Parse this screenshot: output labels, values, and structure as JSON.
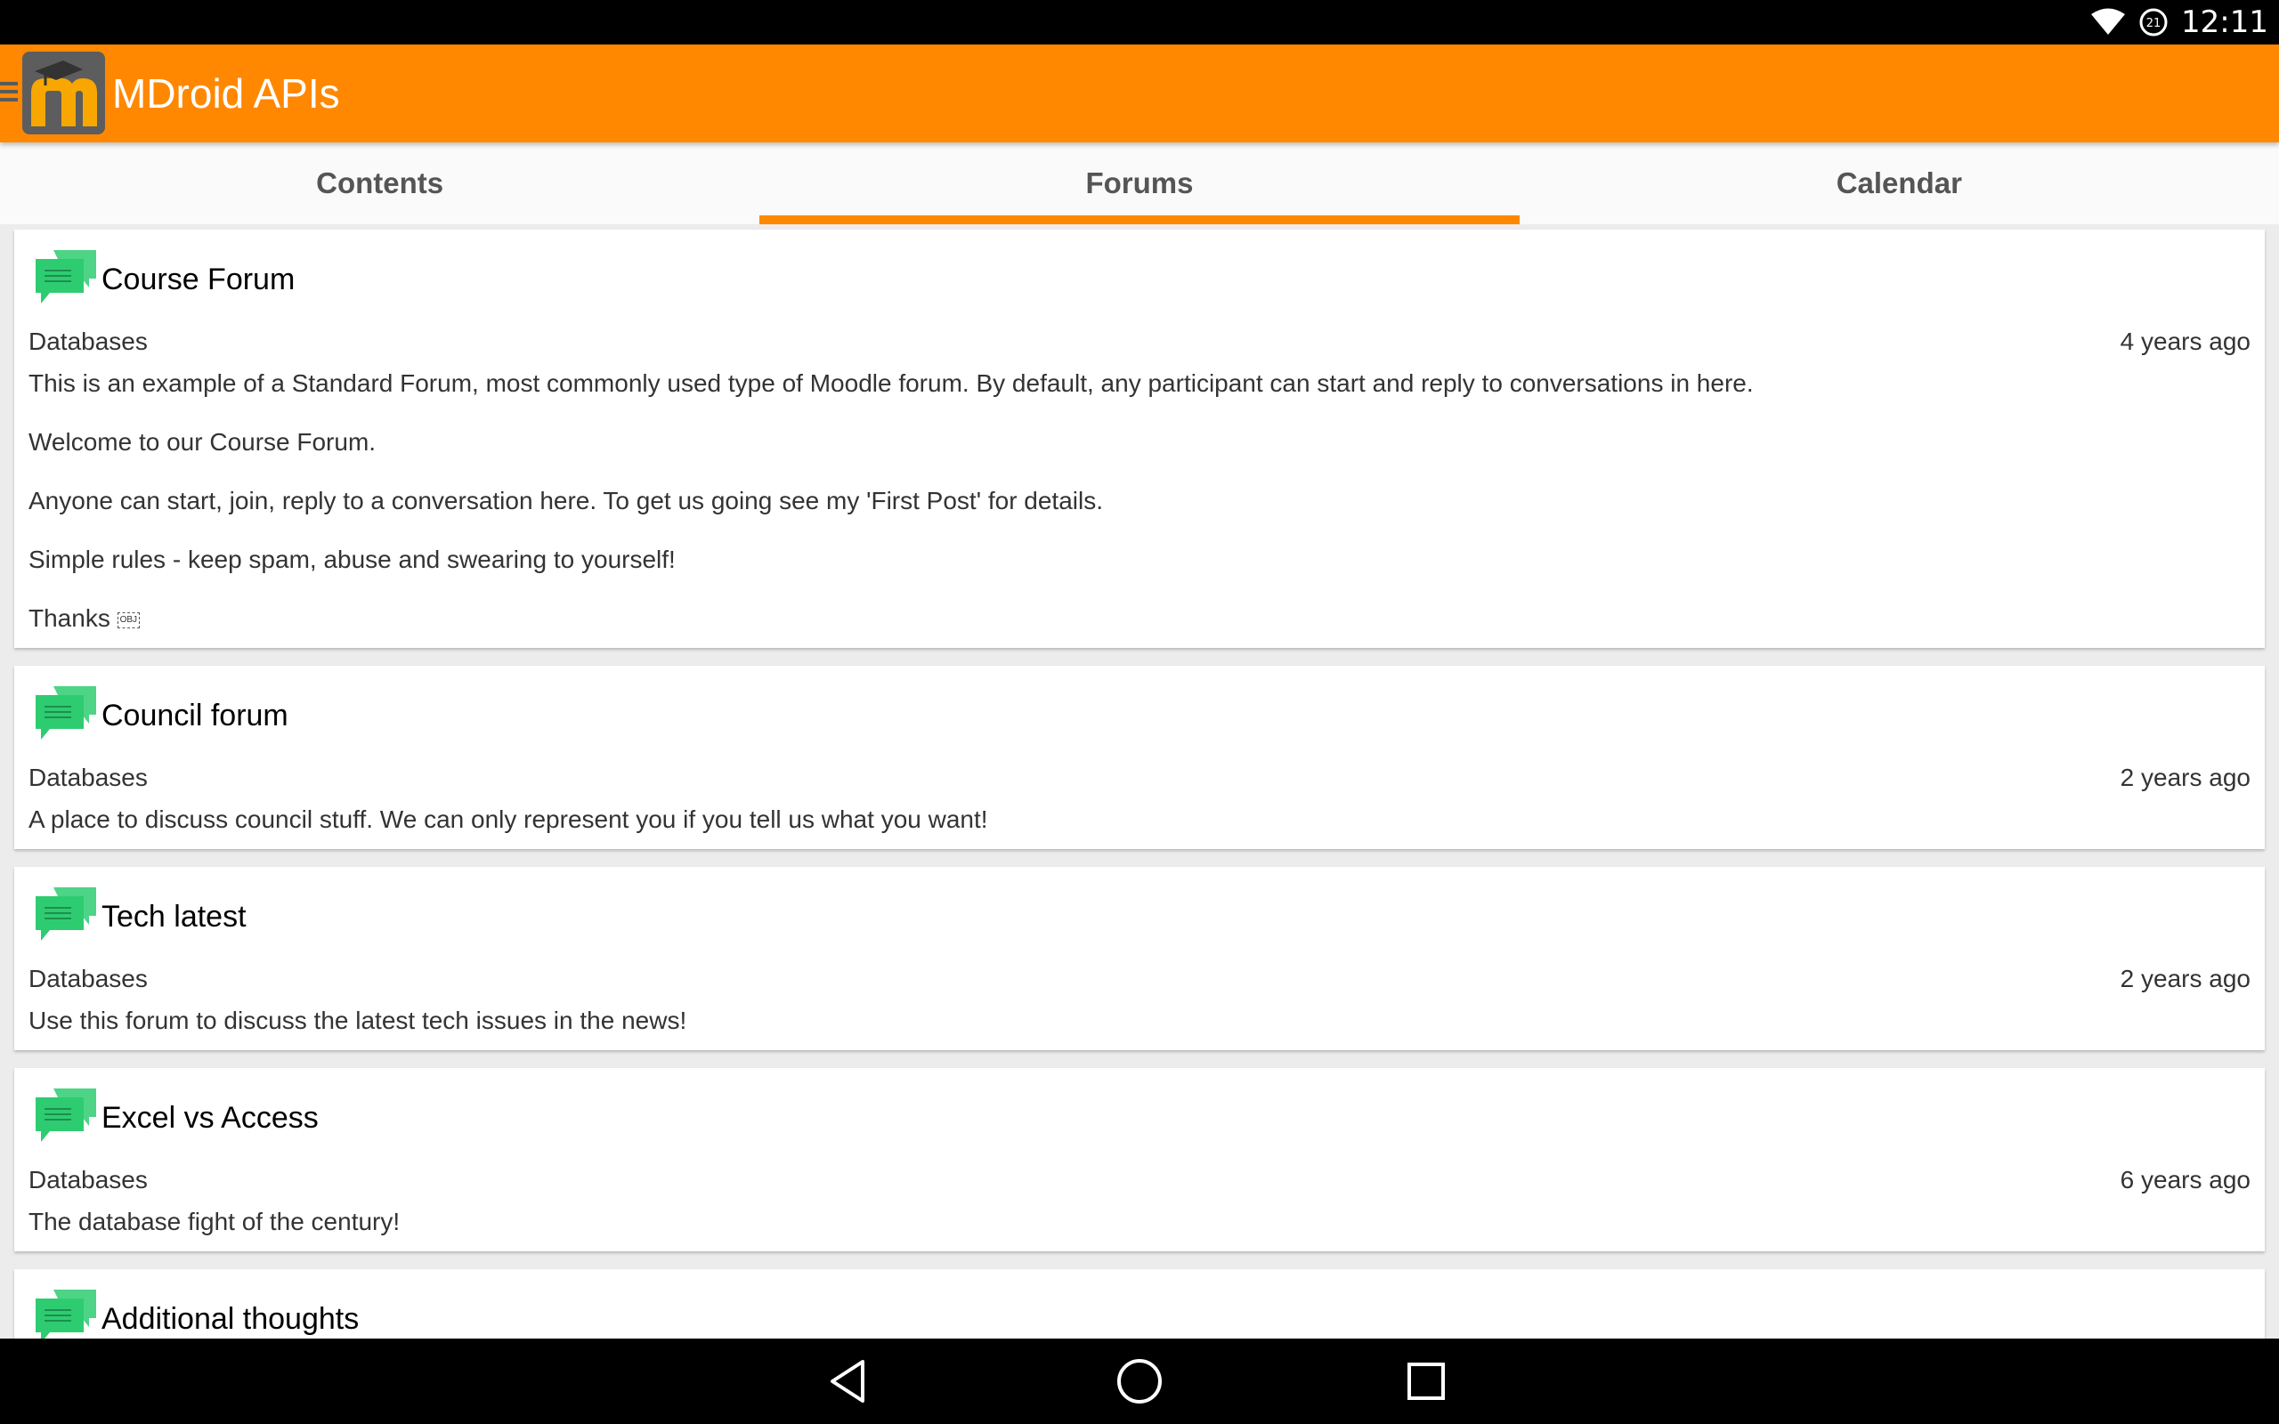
{
  "status_bar": {
    "time": "12:11",
    "battery_level": "21"
  },
  "app_bar": {
    "title": "MDroid APIs"
  },
  "tabs": [
    {
      "label": "Contents",
      "active": false
    },
    {
      "label": "Forums",
      "active": true
    },
    {
      "label": "Calendar",
      "active": false
    }
  ],
  "forums": [
    {
      "title": "Course Forum",
      "category": "Databases",
      "time": "4 years ago",
      "paragraphs": [
        "This is an example of a Standard Forum, most commonly used type of Moodle forum. By default, any participant can start and reply to conversations in here.",
        "Welcome to our Course Forum.",
        "Anyone can start, join, reply to a conversation here. To get us going see my 'First Post' for details.",
        "Simple rules - keep spam, abuse and swearing to yourself!",
        "Thanks"
      ],
      "obj_marker": "OBJ"
    },
    {
      "title": "Council forum",
      "category": "Databases",
      "time": "2 years ago",
      "paragraphs": [
        "A place to discuss council stuff. We can only represent you if you tell us what you want!"
      ]
    },
    {
      "title": "Tech latest",
      "category": "Databases",
      "time": "2 years ago",
      "paragraphs": [
        "Use this forum to discuss the latest tech issues in the news!"
      ]
    },
    {
      "title": "Excel vs Access",
      "category": "Databases",
      "time": "6 years ago",
      "paragraphs": [
        "The database fight of the century!"
      ]
    },
    {
      "title": "Additional thoughts"
    }
  ],
  "colors": {
    "accent": "#ff8800",
    "forum_icon": "#2ecc71"
  }
}
